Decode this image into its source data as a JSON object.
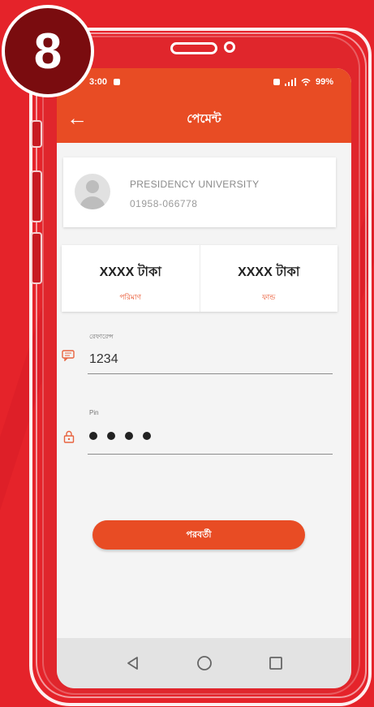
{
  "step_badge": "8",
  "status_bar": {
    "time": "3:00",
    "battery": "99%"
  },
  "app_bar": {
    "back_icon": "arrow-left-icon",
    "title": "পেমেন্ট"
  },
  "profile": {
    "name": "PRESIDENCY UNIVERSITY",
    "phone": "01958-066778"
  },
  "balances": [
    {
      "value": "XXXX টাকা",
      "label": "পরিমাণ"
    },
    {
      "value": "XXXX টাকা",
      "label": "ফান্ড"
    }
  ],
  "reference_field": {
    "label": "রেফারেন্স",
    "value": "1234",
    "icon": "message-icon"
  },
  "pin_field": {
    "label": "Pin",
    "dots": 4,
    "icon": "lock-icon"
  },
  "confirm_button": {
    "label": "পরবর্তী"
  },
  "nav_bar": {
    "icons": [
      "back-triangle-icon",
      "home-circle-icon",
      "recents-square-icon"
    ]
  },
  "colors": {
    "background": "#e5232a",
    "accent": "#e84c24",
    "badge": "#7a0c0f"
  }
}
